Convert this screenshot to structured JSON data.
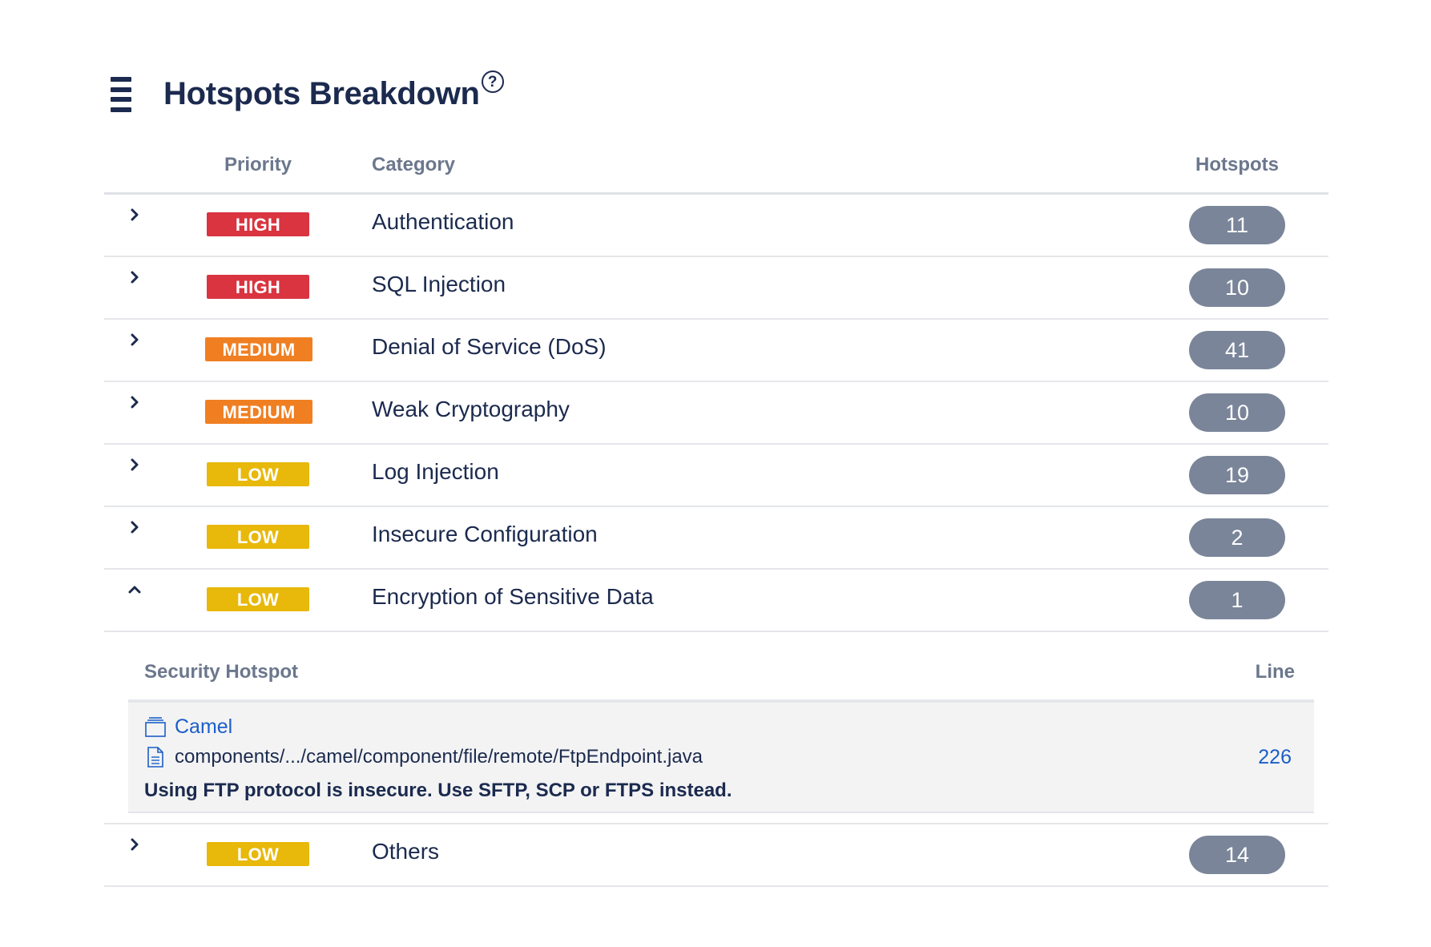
{
  "header": {
    "title": "Hotspots Breakdown",
    "help_glyph": "?"
  },
  "table": {
    "columns": {
      "priority": "Priority",
      "category": "Category",
      "hotspots": "Hotspots"
    },
    "rows": [
      {
        "priority": "HIGH",
        "category": "Authentication",
        "hotspots": "11",
        "expanded": false
      },
      {
        "priority": "HIGH",
        "category": "SQL Injection",
        "hotspots": "10",
        "expanded": false
      },
      {
        "priority": "MEDIUM",
        "category": "Denial of Service (DoS)",
        "hotspots": "41",
        "expanded": false
      },
      {
        "priority": "MEDIUM",
        "category": "Weak Cryptography",
        "hotspots": "10",
        "expanded": false
      },
      {
        "priority": "LOW",
        "category": "Log Injection",
        "hotspots": "19",
        "expanded": false
      },
      {
        "priority": "LOW",
        "category": "Insecure Configuration",
        "hotspots": "2",
        "expanded": false
      },
      {
        "priority": "LOW",
        "category": "Encryption of Sensitive Data",
        "hotspots": "1",
        "expanded": true
      },
      {
        "priority": "LOW",
        "category": "Others",
        "hotspots": "14",
        "expanded": false
      }
    ],
    "detail": {
      "columns": {
        "hotspot": "Security Hotspot",
        "line": "Line"
      },
      "items": [
        {
          "project": "Camel",
          "file": "components/.../camel/component/file/remote/FtpEndpoint.java",
          "message": "Using FTP protocol is insecure. Use SFTP, SCP or FTPS instead.",
          "line": "226"
        }
      ]
    }
  },
  "colors": {
    "high": "#d93440",
    "medium": "#f07f22",
    "low": "#e8b80a",
    "count_pill": "#7a8599",
    "link": "#1b5ec8",
    "text": "#1b2a4e"
  },
  "icons": {
    "menu": "menu-icon",
    "help": "help-circle-icon",
    "collapsed": "chevron-right-icon",
    "expanded": "chevron-up-icon",
    "project": "folder-icon",
    "file": "file-icon"
  }
}
